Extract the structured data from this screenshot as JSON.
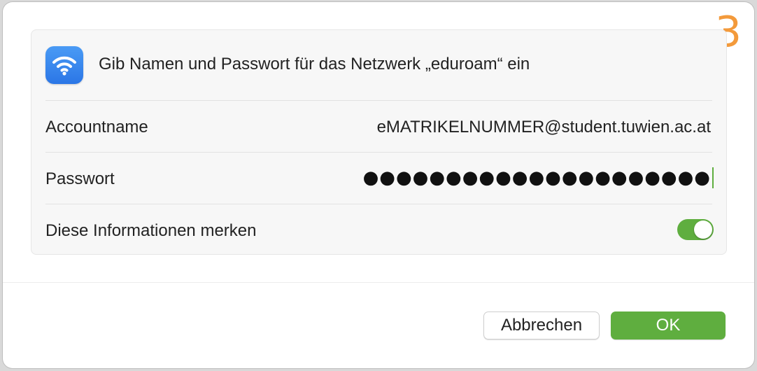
{
  "step_number": "3",
  "dialog": {
    "icon": "wifi-icon",
    "prompt": "Gib Namen und Passwort für das Netzwerk „eduroam“ ein",
    "fields": {
      "account_label": "Accountname",
      "account_value": "eMATRIKELNUMMER@student.tuwien.ac.at",
      "password_label": "Passwort",
      "password_value": "●●●●●●●●●●●●●●●●●●●●●",
      "remember_label": "Diese Informationen merken",
      "remember_on": true
    },
    "buttons": {
      "cancel": "Abbrechen",
      "ok": "OK"
    }
  },
  "colors": {
    "accent_green": "#5fae3f",
    "step_orange": "#f39a3b",
    "wifi_blue": "#2b76e6"
  }
}
